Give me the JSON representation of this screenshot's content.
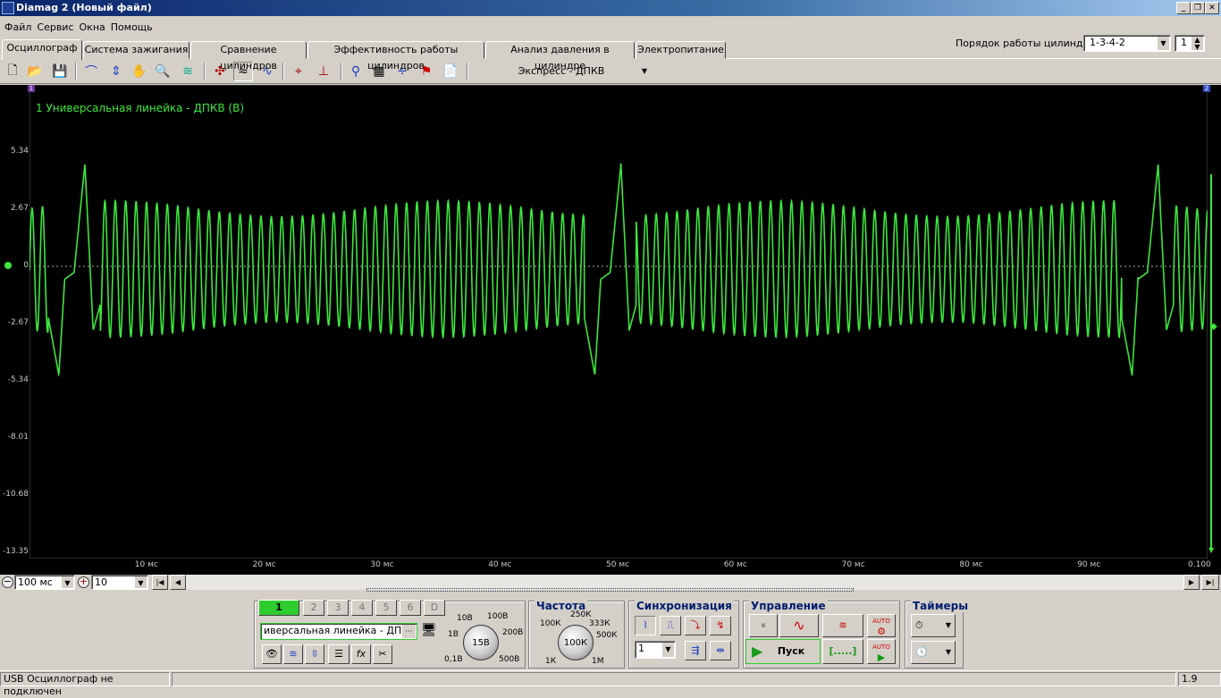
{
  "window": {
    "title": "Diamag 2 (Новый файл)"
  },
  "menu": [
    "Файл",
    "Сервис",
    "Окна",
    "Помощь"
  ],
  "cylinder_order": {
    "label": "Порядок работы цилиндров",
    "value": "1-3-4-2",
    "spin_value": "1"
  },
  "tabs": [
    "Осциллограф",
    "Система зажигания",
    "Сравнение цилиндров",
    "Эффективность работы цилиндров",
    "Анализ давления в цилиндре",
    "Электропитание"
  ],
  "toolbar": {
    "preset": "Экспресс - ДПКВ"
  },
  "scope": {
    "channel_label": "1 Универсальная линейка - ДПКВ (В)",
    "marker_left": "1",
    "marker_right": "2",
    "y_ticks": [
      "5.34",
      "2.67",
      "0",
      "-2.67",
      "-5.34",
      "-8.01",
      "-10.68",
      "-13.35"
    ],
    "x_ticks": [
      "10 мс",
      "20 мс",
      "30 мс",
      "40 мс",
      "50 мс",
      "60 мс",
      "70 мс",
      "80 мс",
      "90 мс",
      "0.100"
    ]
  },
  "chart_data": {
    "type": "line",
    "title": "",
    "ylabel": "",
    "xlim": [
      0,
      100
    ],
    "ylim": [
      -13.35,
      5.34
    ],
    "series": [
      {
        "name": "1 Универсальная линейка - ДПКВ (В)",
        "description_free": true,
        "period_ms": 0.883,
        "teeth_per_rev": 58,
        "gap_at_ms": [
          3.8,
          49.3,
          94.9
        ],
        "amplitude_v": 3.6,
        "peak_gap_v": 4.8,
        "trough_gap_v": -5.0
      }
    ],
    "color": "#3ce83c"
  },
  "timebase": {
    "value": "100 мс",
    "count": "10"
  },
  "channels": [
    "1",
    "2",
    "3",
    "4",
    "5",
    "6",
    "D"
  ],
  "sensor_name": "иверсальная линейка - ДПКВ",
  "voltage_knob": {
    "value": "15В",
    "labels": [
      "10В",
      "100В",
      "1В",
      "200В",
      "0,1В",
      "500В"
    ]
  },
  "frequency": {
    "title": "Частота",
    "value": "100К",
    "labels": [
      "250К",
      "100К",
      "333К",
      "500К",
      "1К",
      "1М"
    ]
  },
  "sync": {
    "title": "Синхронизация",
    "channel": "1"
  },
  "control": {
    "title": "Управление",
    "start_label": "Пуск",
    "range_label": "[.....]",
    "auto_label": "AUTO"
  },
  "timers": {
    "title": "Таймеры"
  },
  "status": {
    "message": "USB Осциллограф не подключен",
    "version": "1.9"
  }
}
